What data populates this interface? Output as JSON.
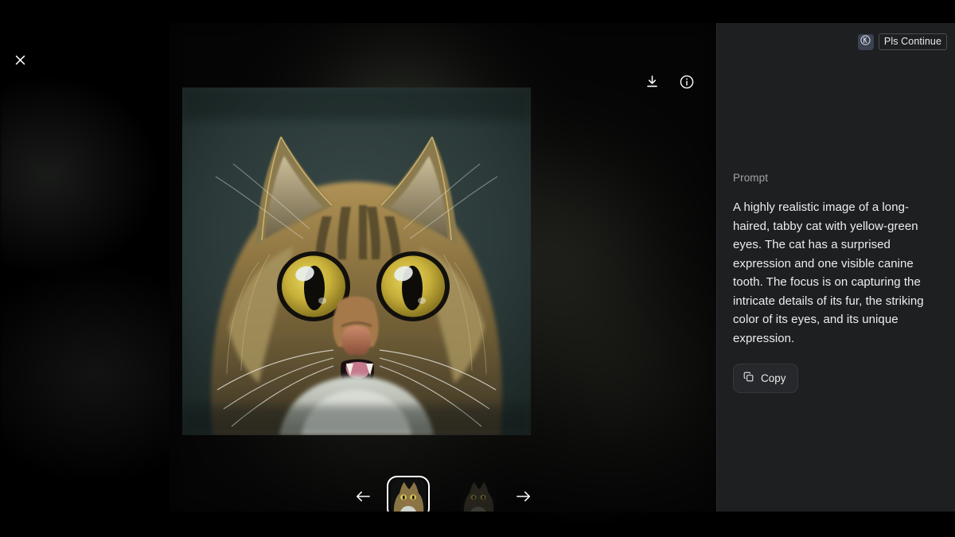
{
  "window": {
    "background_color": "#000000",
    "panel_color": "#1e1f21"
  },
  "close_button": {
    "label": "Close",
    "icon": "close-icon"
  },
  "toolbar": {
    "download": {
      "label": "Download",
      "icon": "download-icon"
    },
    "info": {
      "label": "Image info",
      "icon": "info-icon"
    }
  },
  "viewer": {
    "image_alt": "A highly realistic image of a long-haired, tabby cat with yellow-green eyes",
    "navigation": {
      "prev_label": "Previous image",
      "prev_icon": "arrow-left-icon",
      "next_label": "Next image",
      "next_icon": "arrow-right-icon"
    },
    "thumbnails": [
      {
        "alt": "Tabby cat with yellow-green eyes, surprised expression",
        "selected": true
      },
      {
        "alt": "Darker long-haired tabby cat variation",
        "selected": false
      }
    ]
  },
  "sidebar": {
    "user_badge": {
      "avatar_initial": "K",
      "avatar_icon": "circled-k-avatar-icon",
      "status_label": "Pls Continue"
    },
    "prompt": {
      "label": "Prompt",
      "text": "A highly realistic image of a long-haired, tabby cat with yellow-green eyes. The cat has a surprised expression and one visible canine tooth. The focus is on capturing the intricate details of its fur, the striking color of its eyes, and its unique expression.",
      "copy_button": {
        "label": "Copy",
        "icon": "copy-icon"
      }
    }
  }
}
